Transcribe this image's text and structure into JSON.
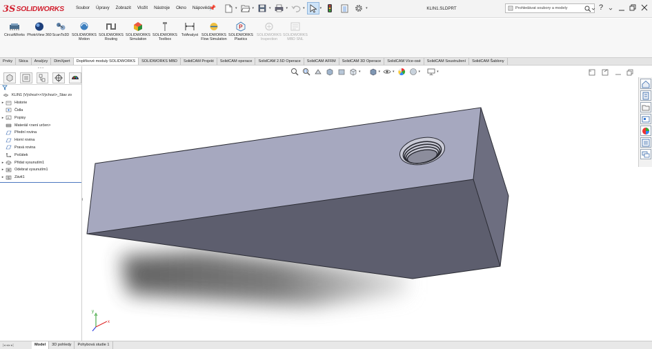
{
  "app": {
    "logo_mark": "3S",
    "logo_text": "SOLIDWORKS",
    "document_title": "KLIN1.SLDPRT"
  },
  "menu": [
    "Soubor",
    "Úpravy",
    "Zobrazit",
    "Vložit",
    "Nástroje",
    "Okno",
    "Nápověda"
  ],
  "search": {
    "placeholder": "Prohledávat soubory a modely"
  },
  "ribbon": [
    {
      "label": "CircuitWorks",
      "icon": "circuitworks-icon",
      "disabled": false
    },
    {
      "label": "PhotoView 360",
      "icon": "photoview-icon",
      "disabled": false
    },
    {
      "label": "ScanTo3D",
      "icon": "scanto3d-icon",
      "disabled": false
    },
    {
      "label": "SOLIDWORKS Motion",
      "icon": "motion-icon",
      "disabled": false
    },
    {
      "label": "SOLIDWORKS Routing",
      "icon": "routing-icon",
      "disabled": false
    },
    {
      "label": "SOLIDWORKS Simulation",
      "icon": "simulation-icon",
      "disabled": false
    },
    {
      "label": "SOLIDWORKS Toolbox",
      "icon": "toolbox-icon",
      "disabled": false
    },
    {
      "label": "TolAnalyst",
      "icon": "tolanalyst-icon",
      "disabled": false
    },
    {
      "label": "SOLIDWORKS Flow Simulation",
      "icon": "flow-simulation-icon",
      "disabled": false
    },
    {
      "label": "SOLIDWORKS Plastics",
      "icon": "plastics-icon",
      "disabled": false
    },
    {
      "label": "SOLIDWORKS Inspection",
      "icon": "inspection-icon",
      "disabled": true
    },
    {
      "label": "SOLIDWORKS MBD SNL",
      "icon": "mbd-snl-icon",
      "disabled": true
    }
  ],
  "tabs": [
    {
      "label": "Prvky",
      "active": false
    },
    {
      "label": "Skica",
      "active": false
    },
    {
      "label": "Analýzy",
      "active": false
    },
    {
      "label": "DimXpert",
      "active": false
    },
    {
      "label": "Doplňkové moduly SOLIDWORKS",
      "active": true
    },
    {
      "label": "SOLIDWORKS MBD",
      "active": false
    },
    {
      "label": "SolidCAM Projekt",
      "active": false
    },
    {
      "label": "SolidCAM operace",
      "active": false
    },
    {
      "label": "SolidCAM 2.5D Operace",
      "active": false
    },
    {
      "label": "SolidCAM AFRM",
      "active": false
    },
    {
      "label": "SolidCAM 3D Operace",
      "active": false
    },
    {
      "label": "SolidCAM Více-osé",
      "active": false
    },
    {
      "label": "SolidCAM Soustružení",
      "active": false
    },
    {
      "label": "SolidCAM Šablony",
      "active": false
    }
  ],
  "tree": {
    "root": "KLIN1  (Výchozí<<Výchozí>_Stav zo",
    "items": [
      {
        "label": "Historie",
        "expandable": true,
        "icon": "history-icon"
      },
      {
        "label": "Čidla",
        "expandable": false,
        "icon": "sensors-icon"
      },
      {
        "label": "Popisy",
        "expandable": true,
        "icon": "annotations-icon"
      },
      {
        "label": "Materiál <není určen>",
        "expandable": false,
        "icon": "material-icon"
      },
      {
        "label": "Přední rovina",
        "expandable": false,
        "icon": "plane-icon"
      },
      {
        "label": "Horní rovina",
        "expandable": false,
        "icon": "plane-icon"
      },
      {
        "label": "Pravá rovina",
        "expandable": false,
        "icon": "plane-icon"
      },
      {
        "label": "Počátek",
        "expandable": false,
        "icon": "origin-icon"
      },
      {
        "label": "Přidat vysunutím1",
        "expandable": true,
        "icon": "boss-extrude-icon"
      },
      {
        "label": "Odebrat vysunutím1",
        "expandable": true,
        "icon": "cut-extrude-icon"
      },
      {
        "label": "Závit1",
        "expandable": true,
        "icon": "thread-icon"
      }
    ]
  },
  "bottom_tabs": [
    {
      "label": "Model",
      "active": true
    },
    {
      "label": "3D pohledy",
      "active": false
    },
    {
      "label": "Pohybová studie 1",
      "active": false
    }
  ],
  "colors": {
    "brand": "#d2202f",
    "part_top": "#a6a8bf",
    "part_side": "#6d6e80",
    "part_front": "#5c5d6c",
    "selection_blue": "#4b78c0"
  }
}
